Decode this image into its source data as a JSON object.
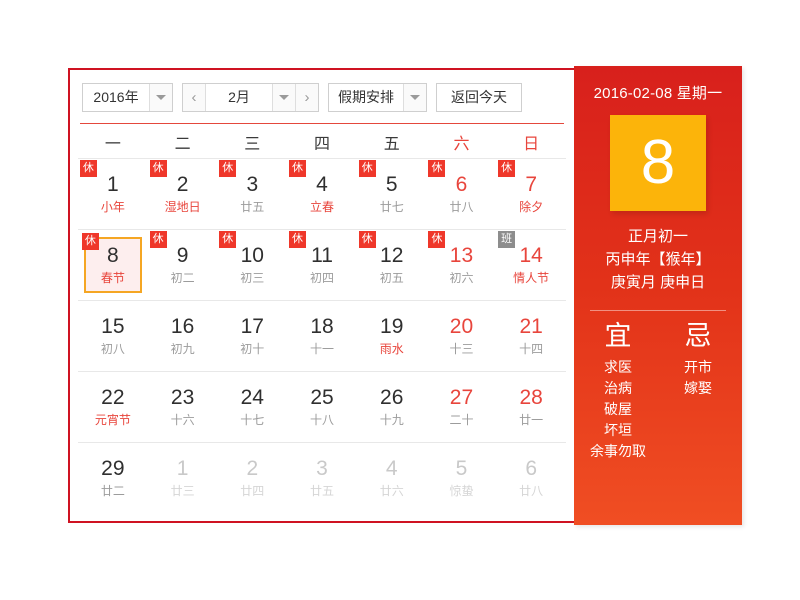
{
  "toolbar": {
    "year_value": "2016年",
    "month_value": "2月",
    "prev_label": "‹",
    "next_label": "›",
    "holiday_value": "假期安排",
    "today_label": "返回今天"
  },
  "weekdays": [
    {
      "label": "一",
      "weekend": false
    },
    {
      "label": "二",
      "weekend": false
    },
    {
      "label": "三",
      "weekend": false
    },
    {
      "label": "四",
      "weekend": false
    },
    {
      "label": "五",
      "weekend": false
    },
    {
      "label": "六",
      "weekend": true
    },
    {
      "label": "日",
      "weekend": true
    }
  ],
  "weeks": [
    [
      {
        "day": "1",
        "lunar": "小年",
        "badge": "休",
        "badge_type": "rest",
        "festival": true,
        "weekend": false,
        "other_month": false,
        "selected": false
      },
      {
        "day": "2",
        "lunar": "湿地日",
        "badge": "休",
        "badge_type": "rest",
        "festival": true,
        "weekend": false,
        "other_month": false,
        "selected": false
      },
      {
        "day": "3",
        "lunar": "廿五",
        "badge": "休",
        "badge_type": "rest",
        "festival": false,
        "weekend": false,
        "other_month": false,
        "selected": false
      },
      {
        "day": "4",
        "lunar": "立春",
        "badge": "休",
        "badge_type": "rest",
        "festival": true,
        "weekend": false,
        "other_month": false,
        "selected": false
      },
      {
        "day": "5",
        "lunar": "廿七",
        "badge": "休",
        "badge_type": "rest",
        "festival": false,
        "weekend": false,
        "other_month": false,
        "selected": false
      },
      {
        "day": "6",
        "lunar": "廿八",
        "badge": "休",
        "badge_type": "rest",
        "festival": false,
        "weekend": true,
        "other_month": false,
        "selected": false
      },
      {
        "day": "7",
        "lunar": "除夕",
        "badge": "休",
        "badge_type": "rest",
        "festival": true,
        "weekend": true,
        "other_month": false,
        "selected": false
      }
    ],
    [
      {
        "day": "8",
        "lunar": "春节",
        "badge": "休",
        "badge_type": "rest",
        "festival": true,
        "weekend": false,
        "other_month": false,
        "selected": true
      },
      {
        "day": "9",
        "lunar": "初二",
        "badge": "休",
        "badge_type": "rest",
        "festival": false,
        "weekend": false,
        "other_month": false,
        "selected": false
      },
      {
        "day": "10",
        "lunar": "初三",
        "badge": "休",
        "badge_type": "rest",
        "festival": false,
        "weekend": false,
        "other_month": false,
        "selected": false
      },
      {
        "day": "11",
        "lunar": "初四",
        "badge": "休",
        "badge_type": "rest",
        "festival": false,
        "weekend": false,
        "other_month": false,
        "selected": false
      },
      {
        "day": "12",
        "lunar": "初五",
        "badge": "休",
        "badge_type": "rest",
        "festival": false,
        "weekend": false,
        "other_month": false,
        "selected": false
      },
      {
        "day": "13",
        "lunar": "初六",
        "badge": "休",
        "badge_type": "rest",
        "festival": false,
        "weekend": true,
        "other_month": false,
        "selected": false
      },
      {
        "day": "14",
        "lunar": "情人节",
        "badge": "班",
        "badge_type": "work",
        "festival": true,
        "weekend": true,
        "other_month": false,
        "selected": false
      }
    ],
    [
      {
        "day": "15",
        "lunar": "初八",
        "badge": "",
        "badge_type": "",
        "festival": false,
        "weekend": false,
        "other_month": false,
        "selected": false
      },
      {
        "day": "16",
        "lunar": "初九",
        "badge": "",
        "badge_type": "",
        "festival": false,
        "weekend": false,
        "other_month": false,
        "selected": false
      },
      {
        "day": "17",
        "lunar": "初十",
        "badge": "",
        "badge_type": "",
        "festival": false,
        "weekend": false,
        "other_month": false,
        "selected": false
      },
      {
        "day": "18",
        "lunar": "十一",
        "badge": "",
        "badge_type": "",
        "festival": false,
        "weekend": false,
        "other_month": false,
        "selected": false
      },
      {
        "day": "19",
        "lunar": "雨水",
        "badge": "",
        "badge_type": "",
        "festival": true,
        "weekend": false,
        "other_month": false,
        "selected": false
      },
      {
        "day": "20",
        "lunar": "十三",
        "badge": "",
        "badge_type": "",
        "festival": false,
        "weekend": true,
        "other_month": false,
        "selected": false
      },
      {
        "day": "21",
        "lunar": "十四",
        "badge": "",
        "badge_type": "",
        "festival": false,
        "weekend": true,
        "other_month": false,
        "selected": false
      }
    ],
    [
      {
        "day": "22",
        "lunar": "元宵节",
        "badge": "",
        "badge_type": "",
        "festival": true,
        "weekend": false,
        "other_month": false,
        "selected": false
      },
      {
        "day": "23",
        "lunar": "十六",
        "badge": "",
        "badge_type": "",
        "festival": false,
        "weekend": false,
        "other_month": false,
        "selected": false
      },
      {
        "day": "24",
        "lunar": "十七",
        "badge": "",
        "badge_type": "",
        "festival": false,
        "weekend": false,
        "other_month": false,
        "selected": false
      },
      {
        "day": "25",
        "lunar": "十八",
        "badge": "",
        "badge_type": "",
        "festival": false,
        "weekend": false,
        "other_month": false,
        "selected": false
      },
      {
        "day": "26",
        "lunar": "十九",
        "badge": "",
        "badge_type": "",
        "festival": false,
        "weekend": false,
        "other_month": false,
        "selected": false
      },
      {
        "day": "27",
        "lunar": "二十",
        "badge": "",
        "badge_type": "",
        "festival": false,
        "weekend": true,
        "other_month": false,
        "selected": false
      },
      {
        "day": "28",
        "lunar": "廿一",
        "badge": "",
        "badge_type": "",
        "festival": false,
        "weekend": true,
        "other_month": false,
        "selected": false
      }
    ],
    [
      {
        "day": "29",
        "lunar": "廿二",
        "badge": "",
        "badge_type": "",
        "festival": false,
        "weekend": false,
        "other_month": false,
        "selected": false
      },
      {
        "day": "1",
        "lunar": "廿三",
        "badge": "",
        "badge_type": "",
        "festival": false,
        "weekend": false,
        "other_month": true,
        "selected": false
      },
      {
        "day": "2",
        "lunar": "廿四",
        "badge": "",
        "badge_type": "",
        "festival": false,
        "weekend": false,
        "other_month": true,
        "selected": false
      },
      {
        "day": "3",
        "lunar": "廿五",
        "badge": "",
        "badge_type": "",
        "festival": false,
        "weekend": false,
        "other_month": true,
        "selected": false
      },
      {
        "day": "4",
        "lunar": "廿六",
        "badge": "",
        "badge_type": "",
        "festival": false,
        "weekend": false,
        "other_month": true,
        "selected": false
      },
      {
        "day": "5",
        "lunar": "惊蛰",
        "badge": "",
        "badge_type": "",
        "festival": false,
        "weekend": true,
        "other_month": true,
        "selected": false
      },
      {
        "day": "6",
        "lunar": "廿八",
        "badge": "",
        "badge_type": "",
        "festival": false,
        "weekend": true,
        "other_month": true,
        "selected": false
      }
    ]
  ],
  "info": {
    "date_line": "2016-02-08 星期一",
    "big_day": "8",
    "lunar_day": "正月初一",
    "lunar_year": "丙申年【猴年】",
    "ganzhi": "庚寅月 庚申日",
    "yi_title": "宜",
    "yi_items": [
      "求医",
      "治病",
      "破屋",
      "坏垣",
      "余事勿取"
    ],
    "ji_title": "忌",
    "ji_items": [
      "开市",
      "嫁娶"
    ]
  },
  "colors": {
    "frame_red": "#cf1322",
    "accent_red": "#e8453c",
    "badge_rest": "#ef372a",
    "badge_work": "#8d8d8d",
    "panel_top": "#d8201c",
    "panel_bottom": "#f04e23",
    "big_day_bg": "#fcb40a",
    "selected_border": "#f5a623"
  }
}
